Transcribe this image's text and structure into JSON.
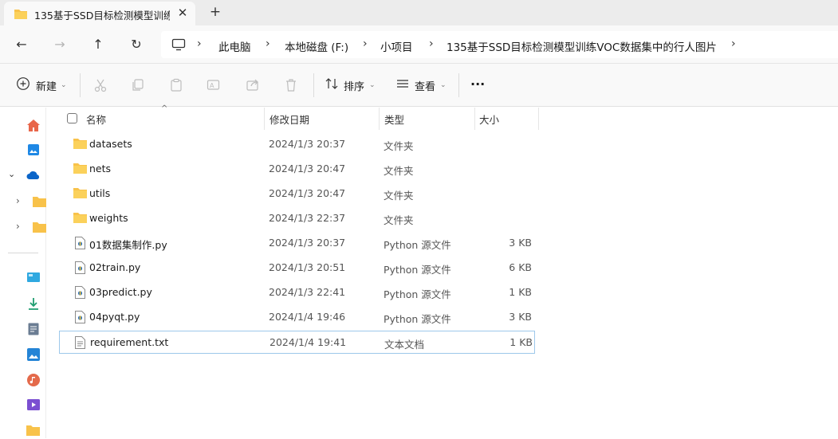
{
  "tab": {
    "title": "135基于SSD目标检测模型训练\\",
    "close": "✕",
    "new_tab": "+"
  },
  "nav": {
    "back": "←",
    "forward": "→",
    "up": "↑",
    "refresh": "↻"
  },
  "breadcrumb": [
    "此电脑",
    "本地磁盘 (F:)",
    "小项目",
    "135基于SSD目标检测模型训练VOC数据集中的行人图片"
  ],
  "toolbar": {
    "new_label": "新建",
    "sort_label": "排序",
    "view_label": "查看",
    "more": "···"
  },
  "columns": {
    "name": "名称",
    "date": "修改日期",
    "type": "类型",
    "size": "大小"
  },
  "files": [
    {
      "name": "datasets",
      "date": "2024/1/3 20:37",
      "type": "文件夹",
      "size": "",
      "icon": "folder-icon"
    },
    {
      "name": "nets",
      "date": "2024/1/3 20:47",
      "type": "文件夹",
      "size": "",
      "icon": "folder-icon"
    },
    {
      "name": "utils",
      "date": "2024/1/3 20:47",
      "type": "文件夹",
      "size": "",
      "icon": "folder-icon"
    },
    {
      "name": "weights",
      "date": "2024/1/3 22:37",
      "type": "文件夹",
      "size": "",
      "icon": "folder-icon"
    },
    {
      "name": "01数据集制作.py",
      "date": "2024/1/3 20:37",
      "type": "Python 源文件",
      "size": "3 KB",
      "icon": "python-file-icon"
    },
    {
      "name": "02train.py",
      "date": "2024/1/3 20:51",
      "type": "Python 源文件",
      "size": "6 KB",
      "icon": "python-file-icon"
    },
    {
      "name": "03predict.py",
      "date": "2024/1/3 22:41",
      "type": "Python 源文件",
      "size": "1 KB",
      "icon": "python-file-icon"
    },
    {
      "name": "04pyqt.py",
      "date": "2024/1/4 19:46",
      "type": "Python 源文件",
      "size": "3 KB",
      "icon": "python-file-icon"
    },
    {
      "name": "requirement.txt",
      "date": "2024/1/4 19:41",
      "type": "文本文档",
      "size": "1 KB",
      "icon": "text-file-icon"
    }
  ],
  "colors": {
    "folder": "#f8c24a",
    "accent": "#0067c0",
    "selection_border": "#9dc8ea"
  }
}
